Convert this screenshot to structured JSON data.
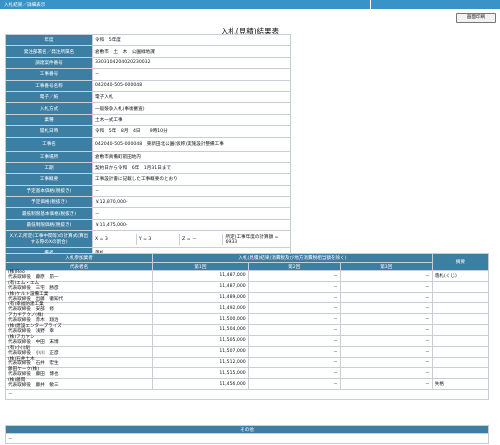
{
  "breadcrumb": "入札結果／詳細表示",
  "print_button": "画面印刷",
  "page_title": "入札(見積)結果表",
  "info": [
    {
      "label": "年度",
      "value": "令和　5年度"
    },
    {
      "label": "発注部署名／発注所属名",
      "value": "倉敷市　土　木　公園緑地課"
    },
    {
      "label": "調達案件番号",
      "value": "3303104204020230032"
    },
    {
      "label": "工事番号",
      "value": "－"
    },
    {
      "label": "工事番号名称",
      "value": "042040-505-000048"
    },
    {
      "label": "電子／紙",
      "value": "電子入札"
    },
    {
      "label": "入札方式",
      "value": "一般競争入札(事後審査)"
    },
    {
      "label": "業種",
      "value": "土木一式工事"
    },
    {
      "label": "開札日時",
      "value": "令和　5年　8月　4日　　9時10分"
    },
    {
      "label": "工事名",
      "value": "042040-505-000048　東新田北公園(仮称)実施設計整備工事"
    },
    {
      "label": "工事場所",
      "value": "倉敷市真備町箭田地内"
    },
    {
      "label": "工期",
      "value": "契約日から令和　6年　1月31日まで"
    },
    {
      "label": "工事概要",
      "value": "工事設計書に記載した工事概要のとおり"
    },
    {
      "label": "予定基本価格(税抜き)",
      "value": "－"
    },
    {
      "label": "予定価格(税抜き)",
      "value": "￥12,870,000-"
    },
    {
      "label": "最低制限基本価格(税抜き)",
      "value": "－"
    },
    {
      "label": "最低制限価格(税抜き)",
      "value": "￥11,475,000-"
    },
    {
      "label": "X,Y,Z,所定(工事中間等)の計算式(算出する際のXの割合)",
      "value": "",
      "formula": [
        "X = 3",
        "Y = 3",
        "Z = －",
        "所定(工事年度の計算額 = 6933"
      ]
    },
    {
      "label": "備考",
      "value": "落札"
    }
  ],
  "bids": {
    "col_company": "入札参加業者",
    "col_rep": "代表者名",
    "col_amount_group": "入札(見積)結果(消費税及び地方消費税相当額を除く)",
    "col_round1": "第1回",
    "col_round2": "第2回",
    "col_round3": "第3回",
    "col_note": "摘要",
    "rows": [
      {
        "company": "(株)Reo",
        "rep": "代表取締役　藤原　昂一",
        "r1": "11,487,000",
        "r2": "－",
        "r3": "－",
        "note": "落札(くじ)"
      },
      {
        "company": "(有)エム・エム",
        "rep": "代表取締役　三宅　勝彦",
        "r1": "11,487,000",
        "r2": "－",
        "r3": "－",
        "note": ""
      },
      {
        "company": "(株)ケルト設備工業",
        "rep": "代表取締役　出藤　徹知代",
        "r1": "11,489,000",
        "r2": "－",
        "r3": "－",
        "note": ""
      },
      {
        "company": "(有)幸福防建工業",
        "rep": "代表取締役　安部　修",
        "r1": "11,492,000",
        "r2": "－",
        "r3": "－",
        "note": ""
      },
      {
        "company": "アカギテクノ(株)",
        "rep": "代表取締役　赤木　翔治",
        "r1": "11,500,000",
        "r2": "－",
        "r3": "－",
        "note": ""
      },
      {
        "company": "(株)建設エンタープライズ",
        "rep": "代表取締役　浅野　幸",
        "r1": "11,504,000",
        "r2": "－",
        "r3": "－",
        "note": ""
      },
      {
        "company": "(株)アカヤシ",
        "rep": "代表取締役　中田　末博",
        "r1": "11,505,000",
        "r2": "－",
        "r3": "－",
        "note": ""
      },
      {
        "company": "(有)小川組",
        "rep": "代表取締役　小川　正彦",
        "r1": "11,507,000",
        "r2": "－",
        "r3": "－",
        "note": ""
      },
      {
        "company": "(株)石井土木",
        "rep": "代表取締役　石井　宏生",
        "r1": "11,512,000",
        "r2": "－",
        "r3": "－",
        "note": ""
      },
      {
        "company": "藤田ケーク(株)",
        "rep": "代表取締役　藤田　博也",
        "r1": "11,515,000",
        "r2": "－",
        "r3": "－",
        "note": ""
      },
      {
        "company": "(株)藤岡",
        "rep": "代表取締役　藤井　敏三",
        "r1": "11,456,000",
        "r2": "－",
        "r3": "－",
        "note": "失格"
      }
    ],
    "tail": "－"
  },
  "other": {
    "header": "その他",
    "value": "－"
  }
}
